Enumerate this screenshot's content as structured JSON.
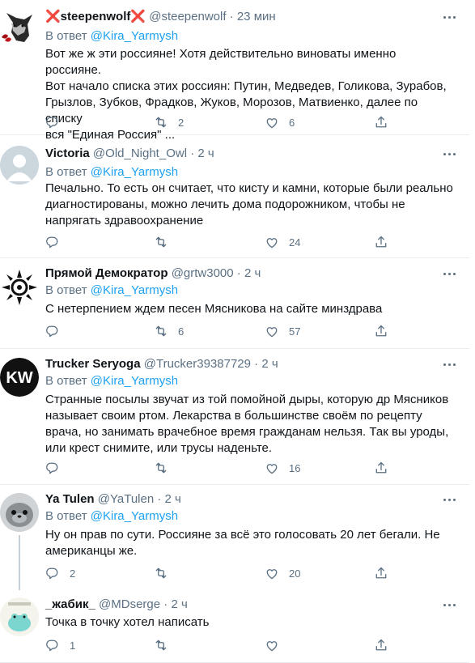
{
  "reply_prefix": "В ответ",
  "tweets": [
    {
      "name": "❌steepenwolf❌",
      "handle": "@steepenwolf",
      "time": "23 мин",
      "reply_to": "@Kira_Yarmysh",
      "text": "Вот же ж эти россияне! Хотя действительно виноваты именно россияне.\nВот начало списка этих россиян: Путин, Медведев, Голикова, Зурабов,\nГрызлов, Зубков, Фрадков, Жуков, Морозов, Матвиенко, далее по списку\nвся \"Единая Россия\" ...",
      "replies": "",
      "retweets": "2",
      "likes": "6",
      "avatar": "wolf-avatar"
    },
    {
      "name": "Victoria",
      "handle": "@Old_Night_Owl",
      "time": "2 ч",
      "reply_to": "@Kira_Yarmysh",
      "text": "Печально. То есть он считает, что кисту и камни, которые были реально\nдиагностированы, можно лечить дома подорожником, чтобы не\nнапрягать здравоохранение",
      "replies": "",
      "retweets": "",
      "likes": "24",
      "avatar": "default-avatar"
    },
    {
      "name": "Прямой Демократор",
      "handle": "@grtw3000",
      "time": "2 ч",
      "reply_to": "@Kira_Yarmysh",
      "text": "С нетерпением ждем песен Мясникова на сайте минздрава",
      "replies": "",
      "retweets": "6",
      "likes": "57",
      "avatar": "emblem-avatar"
    },
    {
      "name": "Trucker Seryoga",
      "handle": "@Trucker39387729",
      "time": "2 ч",
      "reply_to": "@Kira_Yarmysh",
      "text": "Странные посылы звучат из той помойной дыры, которую др Мясников\nназывает своим ртом. Лекарства в большинстве своём по рецепту\nврача, но занимать врачебное время гражданам нельзя. Так вы уроды,\nили крест снимите, или трусы наденьте.",
      "replies": "",
      "retweets": "",
      "likes": "16",
      "avatar": "kw-avatar",
      "avatar_text": "KW"
    },
    {
      "name": "Ya Tulen",
      "handle": "@YaTulen",
      "time": "2 ч",
      "reply_to": "@Kira_Yarmysh",
      "text": "Ну он прав по сути. Россияне за всё это голосовать 20 лет бегали. Не\nамериканцы же.",
      "replies": "2",
      "retweets": "",
      "likes": "20",
      "avatar": "seal-avatar"
    },
    {
      "name": "_жабик_",
      "handle": "@MDserge",
      "time": "2 ч",
      "reply_to": "",
      "text": "Точка в точку хотел написать",
      "replies": "1",
      "retweets": "",
      "likes": "",
      "avatar": "frog-avatar"
    }
  ],
  "colors": {
    "accent": "#1da1f2",
    "secondary_text": "#5b7083",
    "primary_text": "#0f1419",
    "divider": "#e6ecf0"
  }
}
